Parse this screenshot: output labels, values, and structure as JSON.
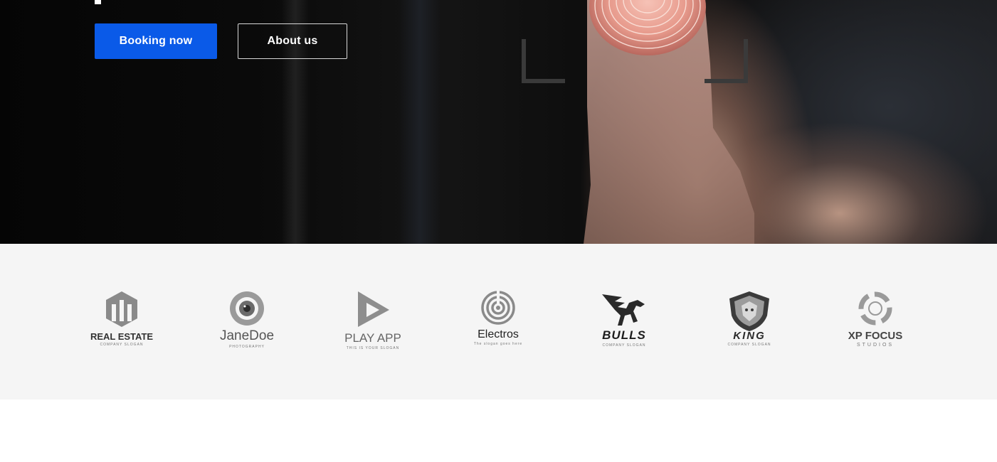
{
  "hero": {
    "title_fragment": "",
    "buttons": {
      "primary_label": "Booking now",
      "secondary_label": "About us"
    }
  },
  "partners": [
    {
      "name": "REAL ESTATE",
      "slogan": "COMPANY SLOGAN",
      "icon": "building-shield-icon"
    },
    {
      "name": "JaneDoe",
      "slogan": "PHOTOGRAPHY",
      "icon": "camera-lens-icon"
    },
    {
      "name": "PLAY APP",
      "slogan": "THIS IS YOUR SLOGAN",
      "icon": "play-triangle-icon"
    },
    {
      "name": "Electros",
      "slogan": "The slogan goes here",
      "icon": "maze-circle-icon"
    },
    {
      "name": "BULLS",
      "slogan": "COMPANY SLOGAN",
      "icon": "winged-bull-icon"
    },
    {
      "name": "KING",
      "slogan": "COMPANY SLOGAN",
      "icon": "lion-shield-icon"
    },
    {
      "name": "XP FOCUS",
      "slogan": "STUDIOS",
      "icon": "focus-ring-icon"
    }
  ],
  "colors": {
    "primary": "#0a5ae8",
    "logo_band": "#f5f5f5",
    "logo_gray": "#8a8a8a"
  }
}
